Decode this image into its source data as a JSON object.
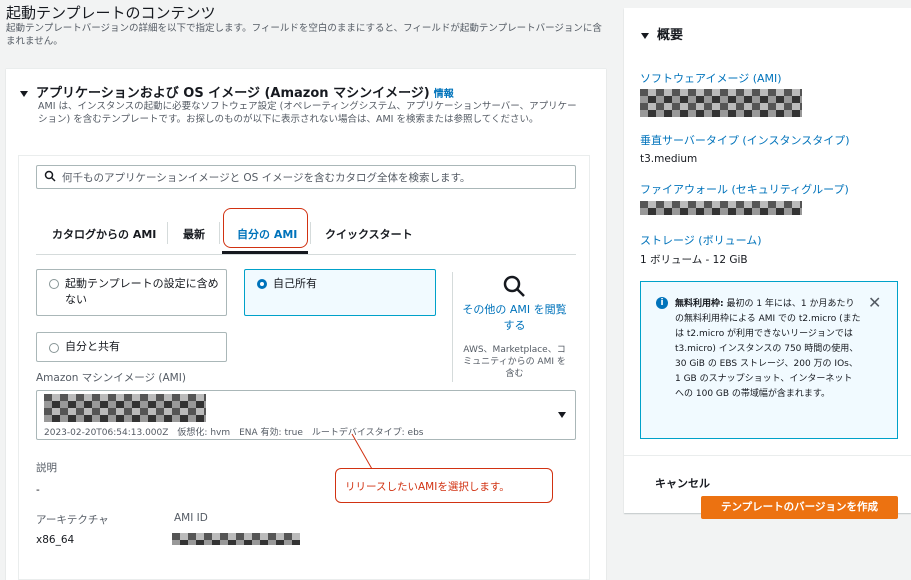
{
  "page": {
    "title": "起動テンプレートのコンテンツ",
    "description": "起動テンプレートバージョンの詳細を以下で指定します。フィールドを空白のままにすると、フィールドが起動テンプレートバージョンに含まれません。"
  },
  "section": {
    "title": "アプリケーションおよび OS イメージ (Amazon マシンイメージ)",
    "info_label": "情報",
    "description": "AMI は、インスタンスの起動に必要なソフトウェア設定 (オペレーティングシステム、アプリケーションサーバー、アプリケーション) を含むテンプレートです。お探しのものが以下に表示されない場合は、AMI を検索または参照してください。"
  },
  "search": {
    "placeholder": "何千ものアプリケーションイメージと OS イメージを含むカタログ全体を検索します。"
  },
  "tabs": [
    {
      "label": "カタログからの AMI"
    },
    {
      "label": "最新"
    },
    {
      "label": "自分の AMI",
      "active": true
    },
    {
      "label": "クイックスタート"
    }
  ],
  "options": {
    "not_included": "起動テンプレートの設定に含めない",
    "owned": "自己所有",
    "shared": "自分と共有"
  },
  "other_ami": {
    "link": "その他の AMI を閲覧する",
    "desc": "AWS、Marketplace、コミュニティからの AMI を含む"
  },
  "ami": {
    "label": "Amazon マシンイメージ (AMI)",
    "meta": "2023-02-20T06:54:13.000Z　仮想化: hvm　ENA 有効: true　ルートデバイスタイプ: ebs"
  },
  "callout": "リリースしたいAMIを選択します。",
  "details": {
    "description_label": "説明",
    "description_value": "-",
    "arch_label": "アーキテクチャ",
    "arch_value": "x86_64",
    "ami_id_label": "AMI ID"
  },
  "summary": {
    "title": "概要",
    "software_image": "ソフトウェアイメージ (AMI)",
    "instance_type_label": "垂直サーバータイプ (インスタンスタイプ)",
    "instance_type_value": "t3.medium",
    "firewall_label": "ファイアウォール (セキュリティグループ)",
    "storage_label": "ストレージ (ボリューム)",
    "storage_value": "1 ボリューム - 12 GiB",
    "free_tier_bold": "無料利用枠:",
    "free_tier_text": "最初の 1 年には、1 か月あたりの無料利用枠による AMI での t2.micro (または t2.micro が利用できないリージョンでは t3.micro) インスタンスの 750 時間の使用、30 GiB の EBS ストレージ、200 万の IOs、1 GB のスナップショット、インターネットへの 100 GB の帯域幅が含まれます。",
    "cancel": "キャンセル",
    "create": "テンプレートのバージョンを作成"
  },
  "colors": {
    "link": "#0073bb",
    "primary_button": "#ec7211",
    "highlight": "#d13212"
  }
}
